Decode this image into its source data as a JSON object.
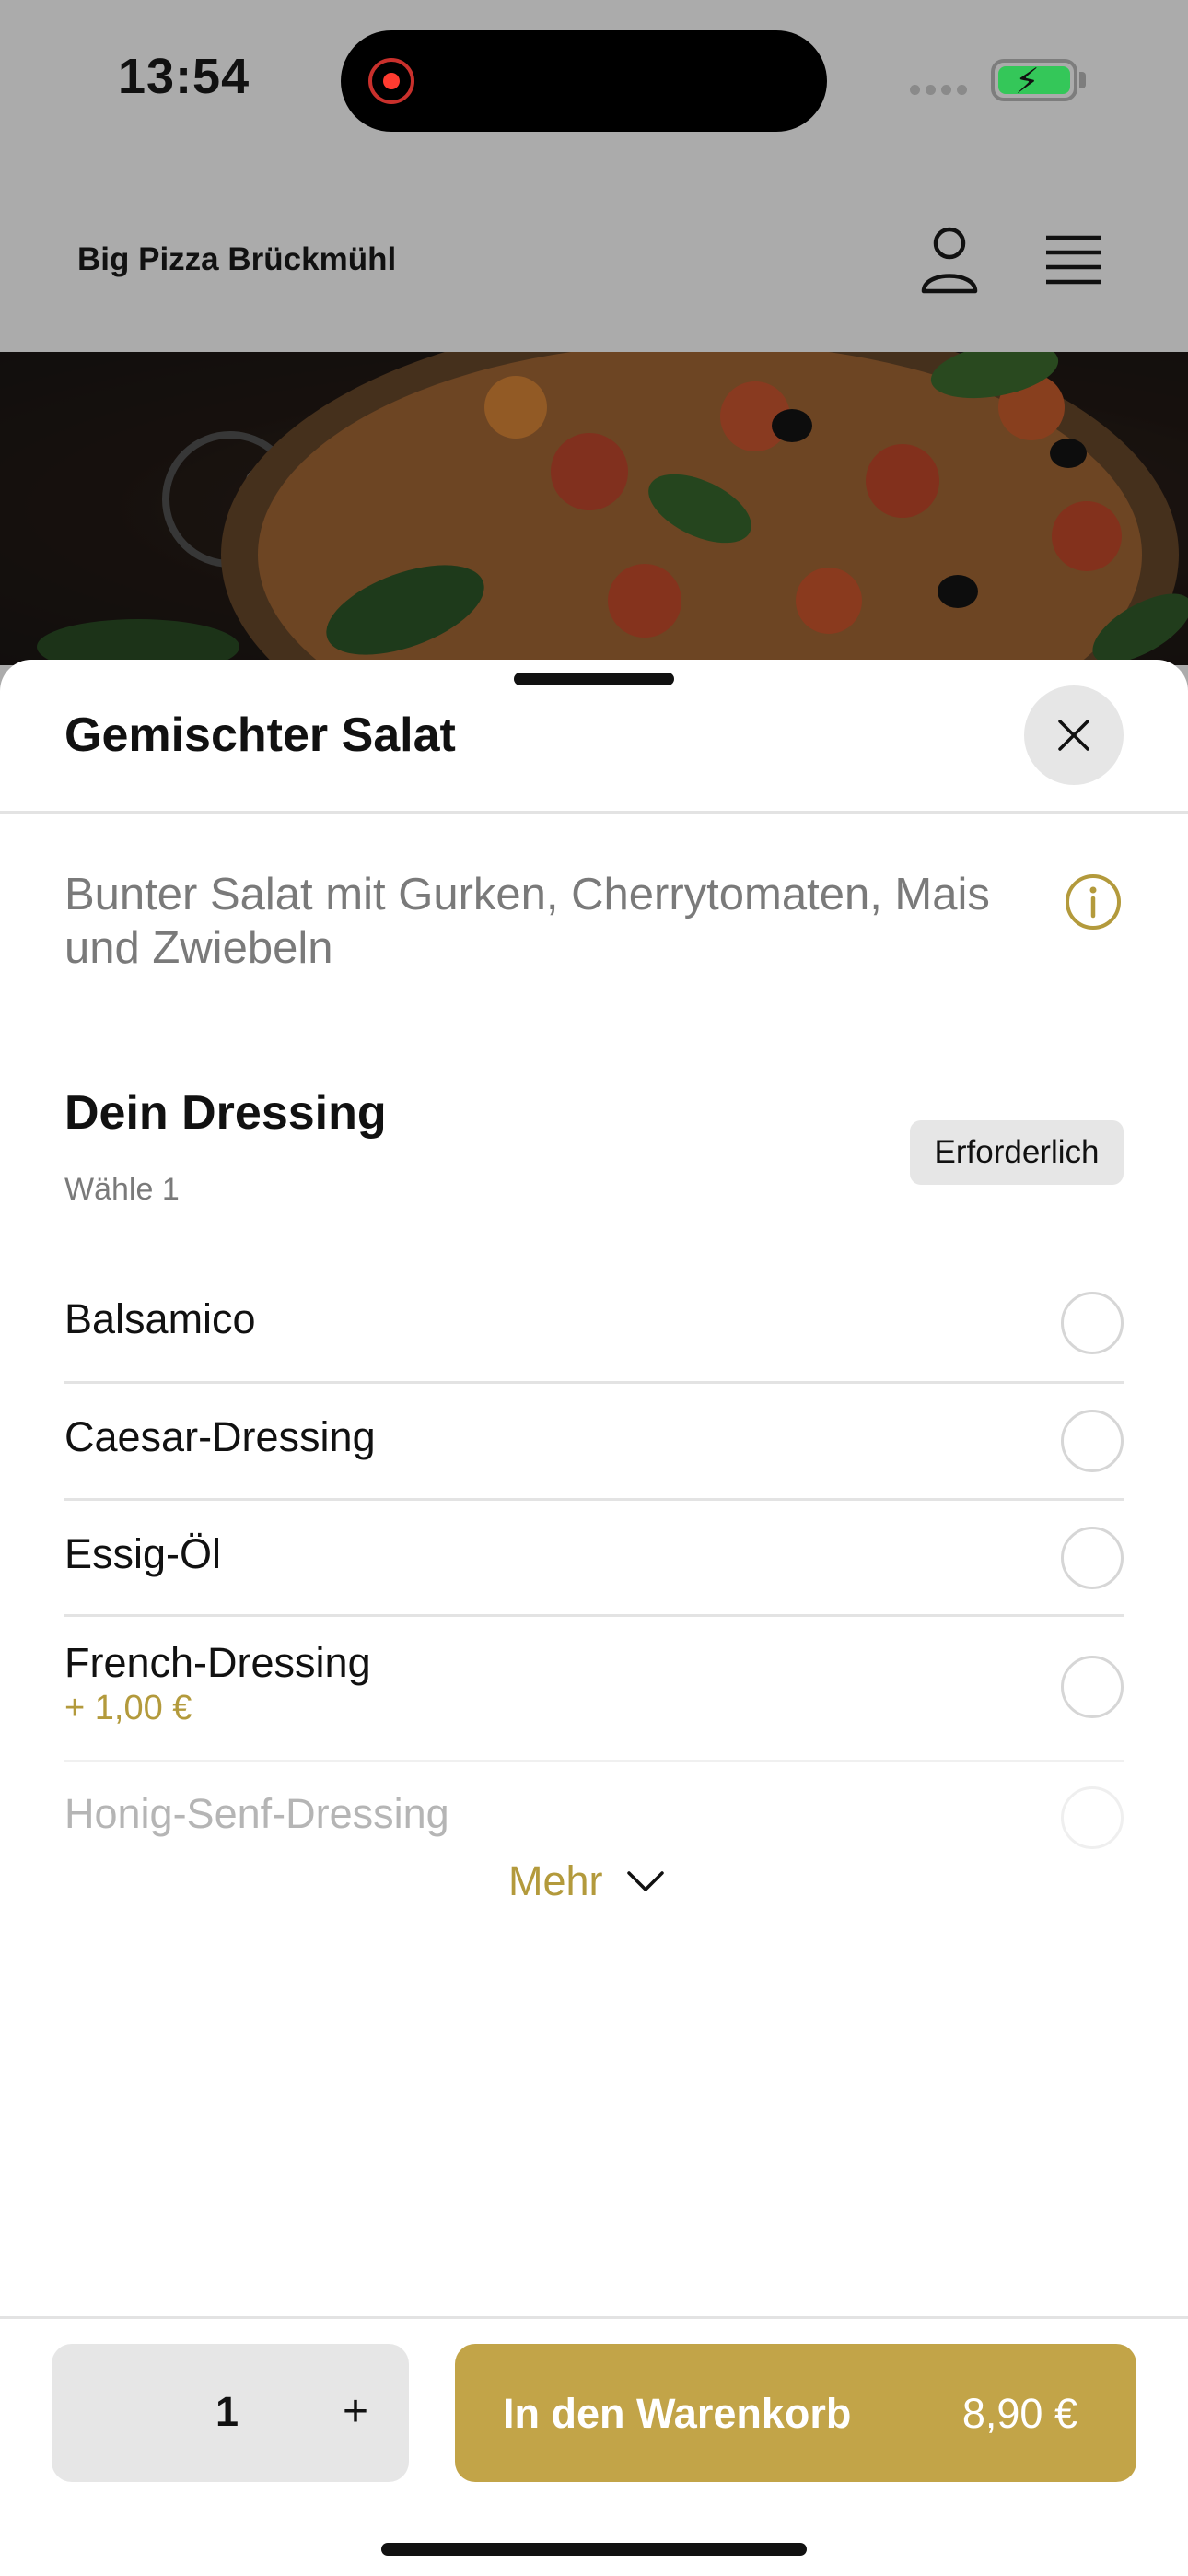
{
  "status_bar": {
    "time": "13:54"
  },
  "header": {
    "brand": "Big Pizza Brückmühl"
  },
  "sheet": {
    "title": "Gemischter Salat",
    "description": "Bunter Salat mit Gurken, Cherrytomaten, Mais und Zwiebeln",
    "section": {
      "title": "Dein Dressing",
      "subtitle": "Wähle 1",
      "badge": "Erforderlich",
      "options": [
        {
          "label": "Balsamico",
          "price": ""
        },
        {
          "label": "Caesar-Dressing",
          "price": ""
        },
        {
          "label": "Essig-Öl",
          "price": ""
        },
        {
          "label": "French-Dressing",
          "price": "+ 1,00 €"
        },
        {
          "label": "Honig-Senf-Dressing",
          "price": ""
        }
      ]
    },
    "more_label": "Mehr"
  },
  "footer": {
    "quantity": "1",
    "plus": "+",
    "cart_label": "In den Warenkorb",
    "cart_price": "8,90 €"
  },
  "colors": {
    "accent": "#c2a448",
    "accent_text": "#b39a3c",
    "scrim": "#ababab"
  },
  "icons": [
    "user-icon",
    "menu-icon",
    "close-icon",
    "info-icon",
    "chevron-down-icon"
  ]
}
